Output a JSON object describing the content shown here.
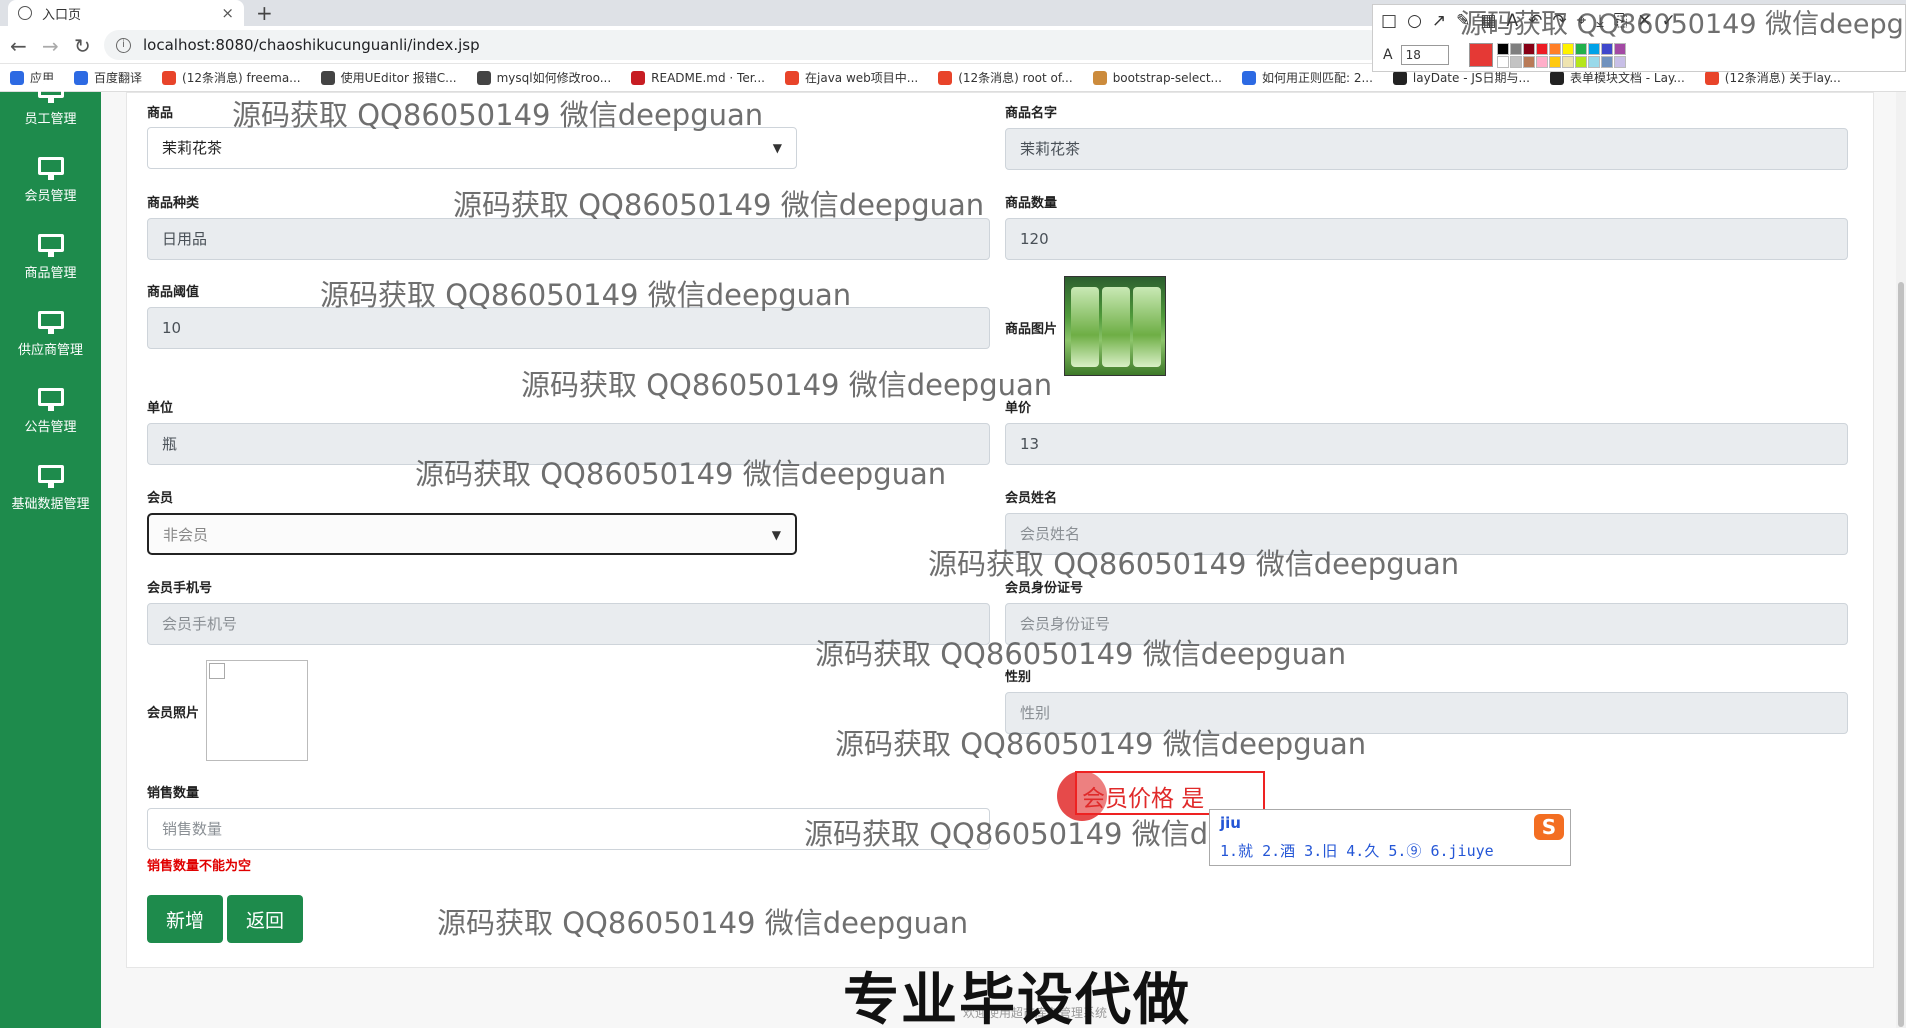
{
  "browser": {
    "tab_title": "入口页",
    "tab_close": "×",
    "new_tab": "+",
    "url": "localhost:8080/chaoshikucunguanli/index.jsp",
    "back": "←",
    "forward": "→",
    "reload": "↻",
    "bookmarks": [
      {
        "label": "应用",
        "color": "#2d6ae3"
      },
      {
        "label": "百度翻译",
        "color": "#2d6ae3"
      },
      {
        "label": "(12条消息) freema...",
        "color": "#e8442a"
      },
      {
        "label": "使用UEditor 报错C...",
        "color": "#444444"
      },
      {
        "label": "mysql如何修改roo...",
        "color": "#444444"
      },
      {
        "label": "README.md · Ter...",
        "color": "#c71d23"
      },
      {
        "label": "在java web项目中...",
        "color": "#e8442a"
      },
      {
        "label": "(12条消息) root of...",
        "color": "#e8442a"
      },
      {
        "label": "bootstrap-select...",
        "color": "#cc8b3c"
      },
      {
        "label": "如何用正则匹配: 2...",
        "color": "#2d6ae3"
      },
      {
        "label": "layDate - JS日期与...",
        "color": "#222222"
      },
      {
        "label": "表单模块文档 - Lay...",
        "color": "#222222"
      },
      {
        "label": "(12条消息) 关于lay...",
        "color": "#e8442a"
      }
    ],
    "annot_font_size": "18"
  },
  "sidebar": {
    "items": [
      {
        "label": "员工管理"
      },
      {
        "label": "会员管理"
      },
      {
        "label": "商品管理"
      },
      {
        "label": "供应商管理"
      },
      {
        "label": "公告管理"
      },
      {
        "label": "基础数据管理"
      }
    ]
  },
  "form": {
    "product_label": "商品",
    "product_value": "茉莉花茶",
    "product_name_label": "商品名字",
    "product_name_value": "茉莉花茶",
    "category_label": "商品种类",
    "category_value": "日用品",
    "quantity_label": "商品数量",
    "quantity_value": "120",
    "threshold_label": "商品阈值",
    "threshold_value": "10",
    "image_label": "商品图片",
    "unit_label": "单位",
    "unit_value": "瓶",
    "price_label": "单价",
    "price_value": "13",
    "member_label": "会员",
    "member_value": "非会员",
    "member_name_label": "会员姓名",
    "member_name_placeholder": "会员姓名",
    "member_phone_label": "会员手机号",
    "member_phone_placeholder": "会员手机号",
    "member_id_label": "会员身份证号",
    "member_id_placeholder": "会员身份证号",
    "member_photo_label": "会员照片",
    "gender_label": "性别",
    "gender_placeholder": "性别",
    "sales_qty_label": "销售数量",
    "sales_qty_placeholder": "销售数量",
    "sales_qty_error": "销售数量不能为空",
    "add_button": "新增",
    "back_button": "返回"
  },
  "ime": {
    "composing": "会员价格 是",
    "pinyin": "jiu",
    "candidates": "1.就 2.酒 3.旧 4.久 5.⑨ 6.jiuye",
    "logo": "S"
  },
  "watermark": "源码获取 QQ86050149 微信deepguan",
  "overlay_text": "专业毕设代做",
  "footer_text": "欢迎使用超市库存管理系统"
}
